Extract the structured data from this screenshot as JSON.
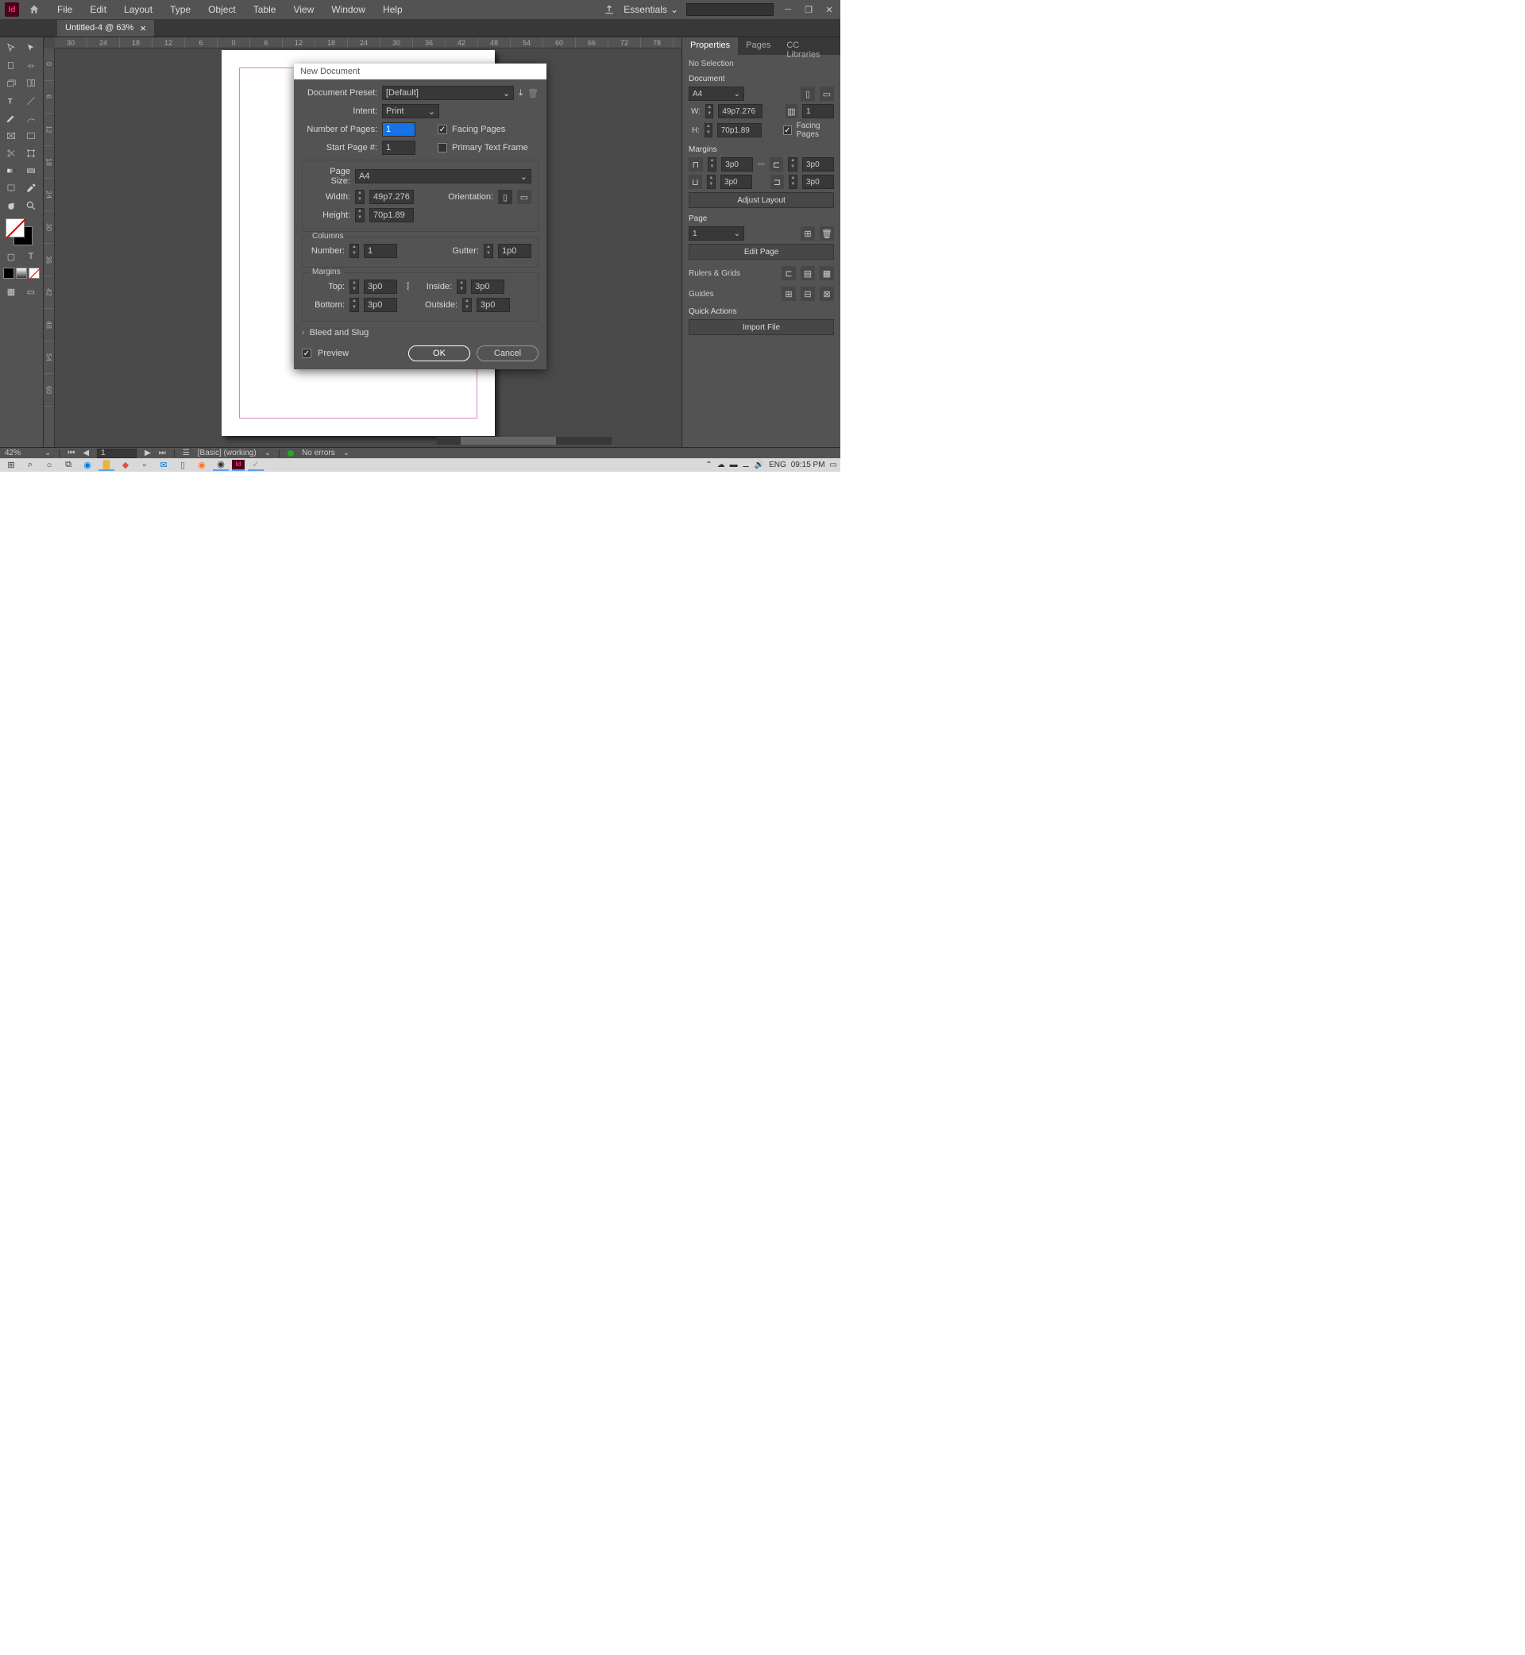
{
  "app": {
    "logo": "Id",
    "workspace": "Essentials"
  },
  "menu": [
    "File",
    "Edit",
    "Layout",
    "Type",
    "Object",
    "Table",
    "View",
    "Window",
    "Help"
  ],
  "tab": {
    "title": "Untitled-4 @ 63%"
  },
  "rulerH": [
    "30",
    "24",
    "18",
    "12",
    "6",
    "0",
    "6",
    "12",
    "18",
    "24",
    "30",
    "36",
    "42",
    "48",
    "54",
    "60",
    "66",
    "72",
    "78"
  ],
  "rulerV": [
    "0",
    "6",
    "12",
    "18",
    "24",
    "30",
    "36",
    "42",
    "48",
    "54",
    "60"
  ],
  "status": {
    "zoom": "42%",
    "page": "1",
    "preflight": "[Basic] (working)",
    "errors": "No errors"
  },
  "panel": {
    "tabs": [
      "Properties",
      "Pages",
      "CC Libraries"
    ],
    "selection": "No Selection",
    "doc_section": "Document",
    "size_preset": "A4",
    "w_label": "W:",
    "w": "49p7.276",
    "h_label": "H:",
    "h": "70p1.89",
    "facing_pages": "Facing Pages",
    "pages_input": "1",
    "margins_title": "Margins",
    "m_tl": "3p0",
    "m_tr": "3p0",
    "m_bl": "3p0",
    "m_br": "3p0",
    "adjust_layout": "Adjust Layout",
    "page_title": "Page",
    "page_sel": "1",
    "edit_page": "Edit Page",
    "rulers_grids": "Rulers & Grids",
    "guides": "Guides",
    "quick_actions": "Quick Actions",
    "import_file": "Import File"
  },
  "dialog": {
    "title": "New Document",
    "preset_label": "Document Preset:",
    "preset": "[Default]",
    "intent_label": "Intent:",
    "intent": "Print",
    "num_pages_label": "Number of Pages:",
    "num_pages": "1",
    "facing_pages": "Facing Pages",
    "start_page_label": "Start Page #:",
    "start_page": "1",
    "primary_text_frame": "Primary Text Frame",
    "page_size_label": "Page Size:",
    "page_size": "A4",
    "width_label": "Width:",
    "width": "49p7.276",
    "height_label": "Height:",
    "height": "70p1.89",
    "orientation_label": "Orientation:",
    "columns_title": "Columns",
    "col_number_label": "Number:",
    "col_number": "1",
    "gutter_label": "Gutter:",
    "gutter": "1p0",
    "margins_title": "Margins",
    "m_top_label": "Top:",
    "m_top": "3p0",
    "m_bottom_label": "Bottom:",
    "m_bottom": "3p0",
    "m_inside_label": "Inside:",
    "m_inside": "3p0",
    "m_outside_label": "Outside:",
    "m_outside": "3p0",
    "bleed_slug": "Bleed and Slug",
    "preview": "Preview",
    "ok": "OK",
    "cancel": "Cancel"
  },
  "taskbar": {
    "lang": "ENG",
    "time": "09:15 PM"
  }
}
